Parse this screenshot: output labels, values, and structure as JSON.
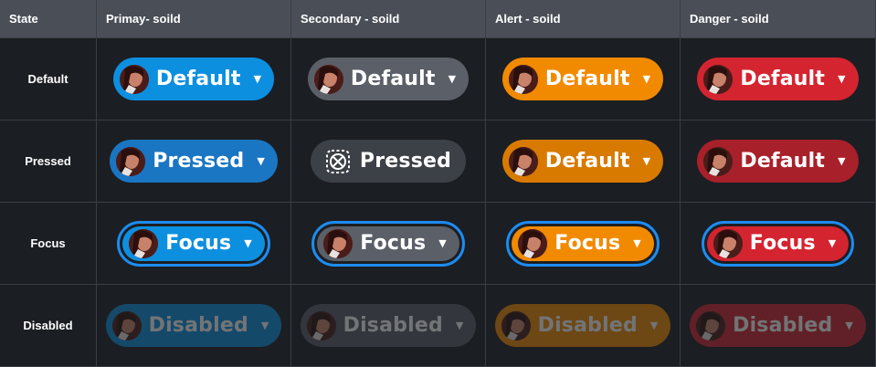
{
  "headers": {
    "state": "State",
    "primary": "Primay- soild",
    "secondary": "Secondary - soild",
    "alert": "Alert - soild",
    "danger": "Danger - soild"
  },
  "rows": {
    "default": {
      "state": "Default",
      "primary": "Default",
      "secondary": "Default",
      "alert": "Default",
      "danger": "Default"
    },
    "pressed": {
      "state": "Pressed",
      "primary": "Pressed",
      "secondary": "Pressed",
      "alert": "Default",
      "danger": "Default"
    },
    "focus": {
      "state": "Focus",
      "primary": "Focus",
      "secondary": "Focus",
      "alert": "Focus",
      "danger": "Focus"
    },
    "disabled": {
      "state": "Disabled",
      "primary": "Disabled",
      "secondary": "Disabled",
      "alert": "Disabled",
      "danger": "Disabled"
    }
  },
  "colors": {
    "primary": "#0d8fe0",
    "primary_pressed": "#1a76c2",
    "secondary": "#5a5f68",
    "secondary_pressed": "#3c4047",
    "alert": "#f28a00",
    "alert_pressed": "#d97a00",
    "danger": "#d42430",
    "danger_pressed": "#a8202a",
    "focus_ring": "#1d8cf0",
    "header_bg": "#4a4e56",
    "table_bg": "#1b1e22"
  },
  "icons": {
    "avatar": "avatar-icon",
    "caret": "caret-down-icon",
    "placeholder": "placeholder-icon"
  }
}
